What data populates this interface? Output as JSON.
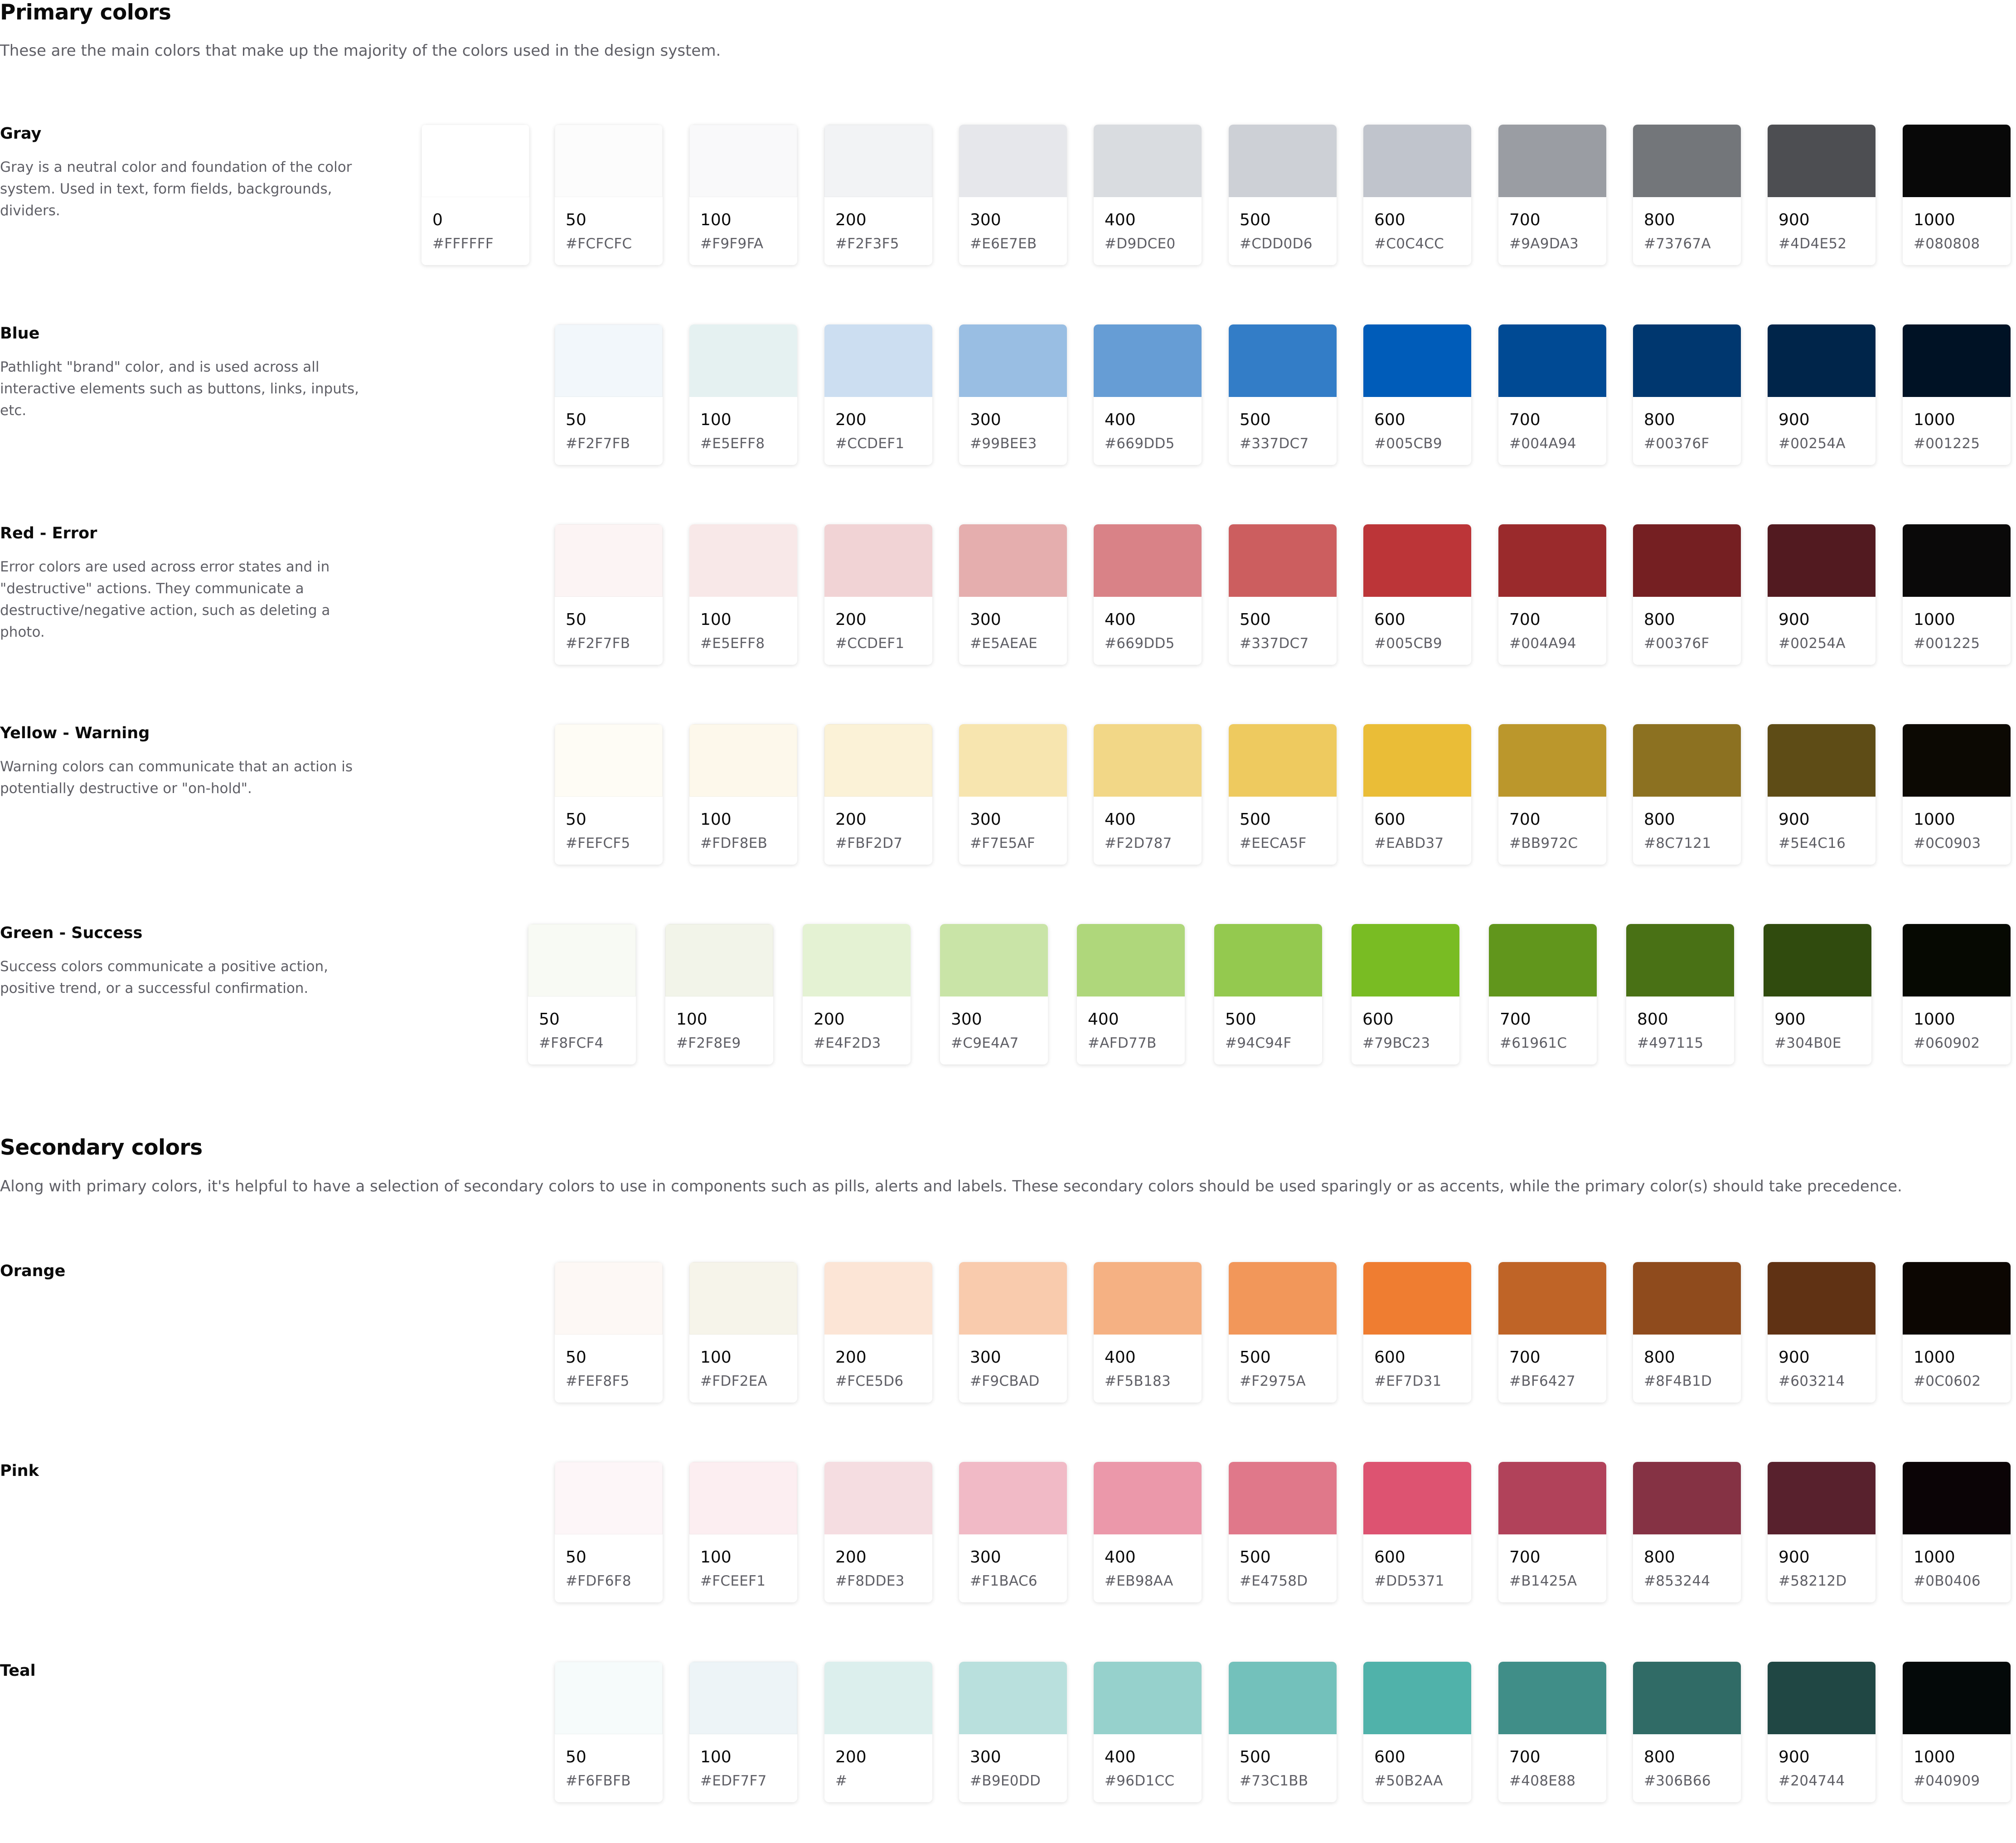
{
  "primary": {
    "title": "Primary colors",
    "description": "These are the main colors that make up the majority of the colors used in the design system."
  },
  "secondary": {
    "title": "Secondary colors",
    "description": "Along with primary colors, it's helpful to have a selection of secondary colors to use in components such as pills, alerts and labels. These secondary colors should be used sparingly or as accents, while the primary color(s) should take precedence."
  },
  "groups": [
    {
      "name": "Gray",
      "description": "Gray is a neutral color and foundation of the color system. Used in text, form fields, backgrounds, dividers.",
      "swatches": [
        {
          "step": "0",
          "hex": "#FFFFFF",
          "color": "#FFFFFF"
        },
        {
          "step": "50",
          "hex": "#FCFCFC",
          "color": "#FCFCFC"
        },
        {
          "step": "100",
          "hex": "#F9F9FA",
          "color": "#F9F9FA"
        },
        {
          "step": "200",
          "hex": "#F2F3F5",
          "color": "#F2F3F5"
        },
        {
          "step": "300",
          "hex": "#E6E7EB",
          "color": "#E6E7EB"
        },
        {
          "step": "400",
          "hex": "#D9DCE0",
          "color": "#D9DCE0"
        },
        {
          "step": "500",
          "hex": "#CDD0D6",
          "color": "#CDD0D6"
        },
        {
          "step": "600",
          "hex": "#C0C4CC",
          "color": "#C0C4CC"
        },
        {
          "step": "700",
          "hex": "#9A9DA3",
          "color": "#9A9DA3"
        },
        {
          "step": "800",
          "hex": "#73767A",
          "color": "#73767A"
        },
        {
          "step": "900",
          "hex": "#4D4E52",
          "color": "#4D4E52"
        },
        {
          "step": "1000",
          "hex": "#080808",
          "color": "#080808"
        }
      ]
    },
    {
      "name": "Blue",
      "description": "Pathlight \"brand\" color, and is used across all interactive elements such as buttons, links, inputs, etc.",
      "swatches": [
        {
          "step": "50",
          "hex": "#F2F7FB",
          "color": "#F2F7FB"
        },
        {
          "step": "100",
          "hex": "#E5EFF8",
          "color": "#E5F1F1"
        },
        {
          "step": "200",
          "hex": "#CCDEF1",
          "color": "#CCDEF1"
        },
        {
          "step": "300",
          "hex": "#99BEE3",
          "color": "#99BEE3"
        },
        {
          "step": "400",
          "hex": "#669DD5",
          "color": "#669DD5"
        },
        {
          "step": "500",
          "hex": "#337DC7",
          "color": "#337DC7"
        },
        {
          "step": "600",
          "hex": "#005CB9",
          "color": "#005CB9"
        },
        {
          "step": "700",
          "hex": "#004A94",
          "color": "#004A94"
        },
        {
          "step": "800",
          "hex": "#00376F",
          "color": "#00376F"
        },
        {
          "step": "900",
          "hex": "#00254A",
          "color": "#00254A"
        },
        {
          "step": "1000",
          "hex": "#001225",
          "color": "#001225"
        }
      ]
    },
    {
      "name": "Red - Error",
      "description": "Error colors are used across error states and in \"destructive\" actions. They communicate a destructive/negative action, such as deleting a photo.",
      "swatches": [
        {
          "step": "50",
          "hex": "#F2F7FB",
          "color": "#FCF4F4"
        },
        {
          "step": "100",
          "hex": "#E5EFF8",
          "color": "#F8E8E8"
        },
        {
          "step": "200",
          "hex": "#CCDEF1",
          "color": "#F1D3D5"
        },
        {
          "step": "300",
          "hex": "#E5AEAE",
          "color": "#E5AEAE"
        },
        {
          "step": "400",
          "hex": "#669DD5",
          "color": "#D98287"
        },
        {
          "step": "500",
          "hex": "#337DC7",
          "color": "#CC5E5F"
        },
        {
          "step": "600",
          "hex": "#005CB9",
          "color": "#BC3538"
        },
        {
          "step": "700",
          "hex": "#004A94",
          "color": "#9A2A2C"
        },
        {
          "step": "800",
          "hex": "#00376F",
          "color": "#751F22"
        },
        {
          "step": "900",
          "hex": "#00254A",
          "color": "#521A20"
        },
        {
          "step": "1000",
          "hex": "#001225",
          "color": "#0A0909"
        }
      ]
    },
    {
      "name": "Yellow - Warning",
      "description": "Warning colors can communicate that an action is potentially destructive or \"on-hold\".",
      "swatches": [
        {
          "step": "50",
          "hex": "#FEFCF5",
          "color": "#FEFCF5"
        },
        {
          "step": "100",
          "hex": "#FDF8EB",
          "color": "#FDF8EB"
        },
        {
          "step": "200",
          "hex": "#FBF2D7",
          "color": "#FBF2D7"
        },
        {
          "step": "300",
          "hex": "#F7E5AF",
          "color": "#F7E5AF"
        },
        {
          "step": "400",
          "hex": "#F2D787",
          "color": "#F2D787"
        },
        {
          "step": "500",
          "hex": "#EECA5F",
          "color": "#EECA5F"
        },
        {
          "step": "600",
          "hex": "#EABD37",
          "color": "#EABD37"
        },
        {
          "step": "700",
          "hex": "#BB972C",
          "color": "#BB972C"
        },
        {
          "step": "800",
          "hex": "#8C7121",
          "color": "#8C7121"
        },
        {
          "step": "900",
          "hex": "#5E4C16",
          "color": "#5E4C16"
        },
        {
          "step": "1000",
          "hex": "#0C0903",
          "color": "#0C0903"
        }
      ]
    },
    {
      "name": "Green - Success",
      "description": "Success colors communicate a positive action, positive trend, or a successful confirmation.",
      "swatches": [
        {
          "step": "50",
          "hex": "#F8FCF4",
          "color": "#F8FAF4"
        },
        {
          "step": "100",
          "hex": "#F2F8E9",
          "color": "#F2F4E9"
        },
        {
          "step": "200",
          "hex": "#E4F2D3",
          "color": "#E4F2D3"
        },
        {
          "step": "300",
          "hex": "#C9E4A7",
          "color": "#C9E4A7"
        },
        {
          "step": "400",
          "hex": "#AFD77B",
          "color": "#AFD77B"
        },
        {
          "step": "500",
          "hex": "#94C94F",
          "color": "#94C94F"
        },
        {
          "step": "600",
          "hex": "#79BC23",
          "color": "#79BC23"
        },
        {
          "step": "700",
          "hex": "#61961C",
          "color": "#61961C"
        },
        {
          "step": "800",
          "hex": "#497115",
          "color": "#497115"
        },
        {
          "step": "900",
          "hex": "#304B0E",
          "color": "#304B0E"
        },
        {
          "step": "1000",
          "hex": "#060902",
          "color": "#060902"
        }
      ]
    },
    {
      "name": "Orange",
      "description": "",
      "swatches": [
        {
          "step": "50",
          "hex": "#FEF8F5",
          "color": "#FDF8F5"
        },
        {
          "step": "100",
          "hex": "#FDF2EA",
          "color": "#F6F4EA"
        },
        {
          "step": "200",
          "hex": "#FCE5D6",
          "color": "#FCE5D6"
        },
        {
          "step": "300",
          "hex": "#F9CBAD",
          "color": "#F9CBAD"
        },
        {
          "step": "400",
          "hex": "#F5B183",
          "color": "#F5B183"
        },
        {
          "step": "500",
          "hex": "#F2975A",
          "color": "#F2975A"
        },
        {
          "step": "600",
          "hex": "#EF7D31",
          "color": "#EF7D31"
        },
        {
          "step": "700",
          "hex": "#BF6427",
          "color": "#BF6427"
        },
        {
          "step": "800",
          "hex": "#8F4B1D",
          "color": "#8F4B1D"
        },
        {
          "step": "900",
          "hex": "#603214",
          "color": "#603214"
        },
        {
          "step": "1000",
          "hex": "#0C0602",
          "color": "#0C0602"
        }
      ]
    },
    {
      "name": "Pink",
      "description": "",
      "swatches": [
        {
          "step": "50",
          "hex": "#FDF6F8",
          "color": "#FDF6F8"
        },
        {
          "step": "100",
          "hex": "#FCEEF1",
          "color": "#FCEEF1"
        },
        {
          "step": "200",
          "hex": "#F8DDE3",
          "color": "#F5DDE1"
        },
        {
          "step": "300",
          "hex": "#F1BAC6",
          "color": "#F1BAC6"
        },
        {
          "step": "400",
          "hex": "#EB98AA",
          "color": "#EB98AA"
        },
        {
          "step": "500",
          "hex": "#E4758D",
          "color": "#E0788A"
        },
        {
          "step": "600",
          "hex": "#DD5371",
          "color": "#DD5371"
        },
        {
          "step": "700",
          "hex": "#B1425A",
          "color": "#B1425A"
        },
        {
          "step": "800",
          "hex": "#853244",
          "color": "#853244"
        },
        {
          "step": "900",
          "hex": "#58212D",
          "color": "#58212D"
        },
        {
          "step": "1000",
          "hex": "#0B0406",
          "color": "#0B0406"
        }
      ]
    },
    {
      "name": "Teal",
      "description": "",
      "swatches": [
        {
          "step": "50",
          "hex": "#F6FBFB",
          "color": "#F6FBFB"
        },
        {
          "step": "100",
          "hex": "#EDF7F7",
          "color": "#EDF4F7"
        },
        {
          "step": "200",
          "hex": "#",
          "color": "#DCEFED"
        },
        {
          "step": "300",
          "hex": "#B9E0DD",
          "color": "#B9E0DD"
        },
        {
          "step": "400",
          "hex": "#96D1CC",
          "color": "#96D1CC"
        },
        {
          "step": "500",
          "hex": "#73C1BB",
          "color": "#73C1BB"
        },
        {
          "step": "600",
          "hex": "#50B2AA",
          "color": "#50B2AA"
        },
        {
          "step": "700",
          "hex": "#408E88",
          "color": "#408E88"
        },
        {
          "step": "800",
          "hex": "#306B66",
          "color": "#306B66"
        },
        {
          "step": "900",
          "hex": "#204744",
          "color": "#204744"
        },
        {
          "step": "1000",
          "hex": "#040909",
          "color": "#040909"
        }
      ]
    }
  ]
}
